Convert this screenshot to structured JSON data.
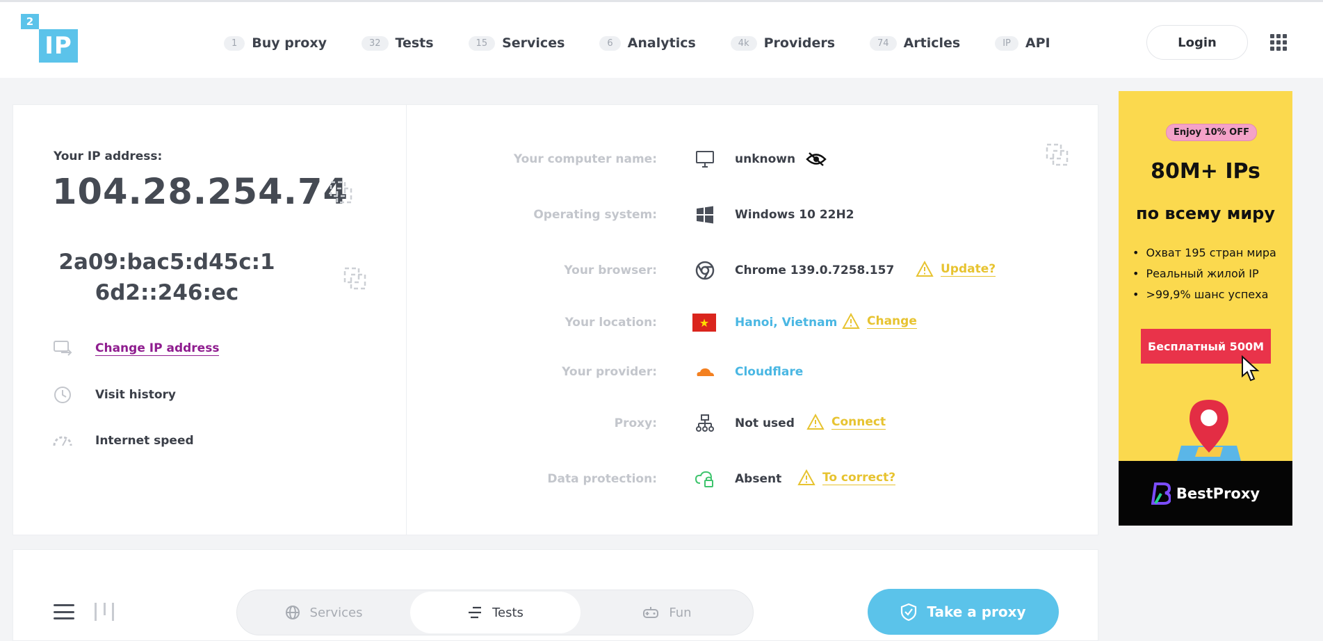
{
  "logo": {
    "small": "2",
    "big": "IP"
  },
  "nav": [
    {
      "badge": "1",
      "label": "Buy proxy"
    },
    {
      "badge": "32",
      "label": "Tests"
    },
    {
      "badge": "15",
      "label": "Services"
    },
    {
      "badge": "6",
      "label": "Analytics"
    },
    {
      "badge": "4k",
      "label": "Providers"
    },
    {
      "badge": "74",
      "label": "Articles"
    },
    {
      "badge": "IP",
      "label": "API"
    }
  ],
  "header": {
    "login_label": "Login"
  },
  "ip": {
    "caption": "Your IP address:",
    "ipv4": "104.28.254.74",
    "ipv6": "2a09:bac5:d45c:16d2::246:ec"
  },
  "left_links": {
    "change_ip": "Change IP address",
    "visit_history": "Visit history",
    "internet_speed": "Internet speed"
  },
  "info": {
    "computer": {
      "label": "Your computer name:",
      "value": "unknown"
    },
    "os": {
      "label": "Operating system:",
      "value": "Windows 10 22H2"
    },
    "browser": {
      "label": "Your browser:",
      "value": "Chrome 139.0.7258.157",
      "warn": "Update?"
    },
    "location": {
      "label": "Your location:",
      "value": "Hanoi, Vietnam",
      "warn": "Change"
    },
    "provider": {
      "label": "Your provider:",
      "value": "Cloudflare"
    },
    "proxy": {
      "label": "Proxy:",
      "value": "Not used",
      "warn": "Connect"
    },
    "protection": {
      "label": "Data protection:",
      "value": "Absent",
      "warn": "To correct?"
    }
  },
  "ad": {
    "badge": "Enjoy 10% OFF",
    "title": "80M+ IPs",
    "subtitle": "по всему миру",
    "bullets": [
      "Охват 195 стран мира",
      "Реальный жилой IP",
      ">99,9% шанс успеха"
    ],
    "cta": "Бесплатный 500М",
    "brand": "BestProxy"
  },
  "bottom": {
    "tabs": [
      "Services",
      "Tests",
      "Fun"
    ],
    "take_proxy": "Take a proxy"
  },
  "colors": {
    "accent": "#5bc3ea",
    "warning": "#e7c330",
    "link_purple": "#8f1d8f",
    "label_gray": "#c3c6cc"
  }
}
